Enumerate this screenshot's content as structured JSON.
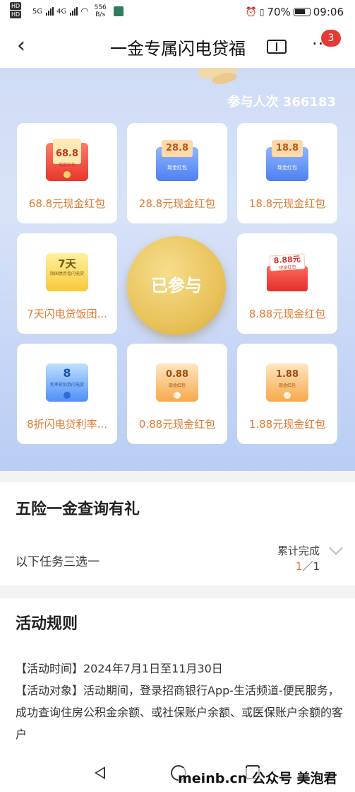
{
  "status_bar": {
    "hd1": "HD",
    "hd2": "HD",
    "net1": "5G",
    "net2": "4G",
    "speed_value": "556",
    "speed_unit": "B/s",
    "battery": "70%",
    "time": "09:06"
  },
  "header": {
    "back_icon": "chevron-left-icon",
    "title": "一金专属闪电贷福",
    "ticket_icon": "ticket-icon",
    "more_icon": "more-dots-icon",
    "badge_count": "3"
  },
  "banner": {
    "participants": "参与人次 366183",
    "join_button": "已参与",
    "prizes": [
      {
        "label": "68.8元现金红包",
        "env_amount": "68.8",
        "env_sub": "现金红包",
        "style": "red"
      },
      {
        "label": "28.8元现金红包",
        "env_amount": "28.8",
        "env_sub": "现金红包",
        "style": "blue"
      },
      {
        "label": "18.8元现金红包",
        "env_amount": "18.8",
        "env_sub": "现金红包",
        "style": "blue"
      },
      {
        "label": "7天闪电贷饭团...",
        "env_amount": "7天",
        "env_sub": "限国债券卷闪电贷",
        "style": "yellow"
      },
      {
        "label": "8.88元现金红包",
        "env_amount": "8.88元",
        "env_sub": "现金红包",
        "style": "gift"
      },
      {
        "label": "8折闪电贷利率...",
        "env_amount": "8",
        "env_sub": "利率折扣券闪电贷",
        "style": "azure"
      },
      {
        "label": "0.88元现金红包",
        "env_amount": "0.88",
        "env_sub": "现金红包",
        "style": "orange"
      },
      {
        "label": "1.88元现金红包",
        "env_amount": "1.88",
        "env_sub": "现金红包",
        "style": "orange"
      }
    ]
  },
  "task": {
    "title": "五险一金查询有礼",
    "description": "以下任务三选一",
    "progress_label": "累计完成",
    "progress_current": "1",
    "progress_sep": "／",
    "progress_total": "1"
  },
  "rules": {
    "title": "活动规则",
    "line1": "【活动时间】2024年7月1日至11月30日",
    "line2": "【活动对象】活动期间，登录招商银行App-生活频道-便民服务，成功查询住房公积金余额、或社保账户余额、或医保账户余额的客户"
  },
  "watermark": "meinb.cn 公众号 美泡君",
  "colors": {
    "accent_orange": "#e17a2f",
    "badge_red": "#e53935",
    "gold": "#e9c35c",
    "banner_blue": "#c7d6f6"
  }
}
